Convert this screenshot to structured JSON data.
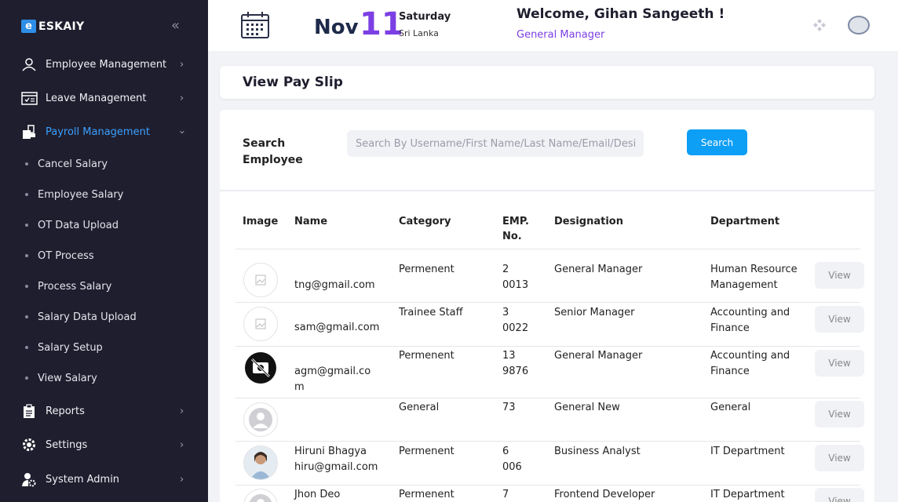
{
  "brand": {
    "logo_letter": "e",
    "logo_text": "ESKAIY"
  },
  "sidebar": {
    "items": [
      {
        "label": "Employee Management",
        "icon": "employee-icon"
      },
      {
        "label": "Leave Management",
        "icon": "calendar-check-icon"
      },
      {
        "label": "Payroll Management",
        "icon": "payroll-icon",
        "active": true
      },
      {
        "label": "Reports",
        "icon": "clipboard-icon"
      },
      {
        "label": "Settings",
        "icon": "gear-icon"
      },
      {
        "label": "System Admin",
        "icon": "user-gear-icon"
      }
    ],
    "sub_items": [
      "Cancel Salary",
      "Employee Salary",
      "OT Data Upload",
      "OT Process",
      "Process Salary",
      "Salary Data Upload",
      "Salary Setup",
      "View Salary"
    ]
  },
  "header": {
    "month": "Nov",
    "day": "11",
    "weekday": "Saturday",
    "country": "Sri Lanka",
    "welcome": "Welcome, Gihan Sangeeth !",
    "role": "General Manager"
  },
  "page": {
    "title": "View Pay Slip",
    "search_label": "Search Employee",
    "search_placeholder": "Search By Username/First Name/Last Name/Email/Designation",
    "search_button": "Search"
  },
  "table": {
    "headers": [
      "Image",
      "Name",
      "Category",
      "EMP. No.",
      "Designation",
      "Department"
    ],
    "view_label": "View",
    "rows": [
      {
        "image": "broken-image-icon",
        "name": "tng@gmail.com",
        "category": "Permenent",
        "emp_no": "2\n0013",
        "designation": "General Manager",
        "department": "Human Resource Management"
      },
      {
        "image": "broken-image-icon",
        "name": "sam@gmail.com",
        "category": "Trainee Staff",
        "emp_no": "3\n0022",
        "designation": "Senior Manager",
        "department": "Accounting and Finance"
      },
      {
        "image": "no-camera-icon",
        "name": "agm@gmail.co\nm",
        "category": "Permenent",
        "emp_no": "13\n9876",
        "designation": "General Manager",
        "department": "Accounting and Finance"
      },
      {
        "image": "default-avatar-icon",
        "name": "",
        "category": "General",
        "emp_no": "73",
        "designation": "General New",
        "department": "General"
      },
      {
        "image": "profile-photo",
        "name": "Hiruni Bhagya\nhiru@gmail.com",
        "category": "Permenent",
        "emp_no": "6\n006",
        "designation": "Business Analyst",
        "department": "IT Department"
      },
      {
        "image": "default-avatar-icon",
        "name": "Jhon Deo",
        "category": "Permenent",
        "emp_no": "7",
        "designation": "Frontend Developer",
        "department": "IT Department"
      }
    ]
  },
  "colors": {
    "sidebar_bg": "#1f1e2e",
    "accent_purple": "#7b3fe4",
    "accent_blue": "#0d9ef5",
    "active_nav": "#3aa0ff"
  }
}
